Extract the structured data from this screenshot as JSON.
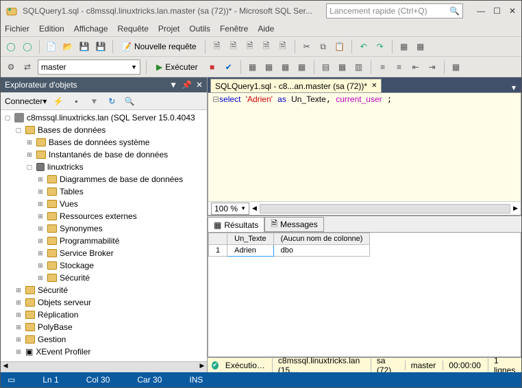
{
  "title": "SQLQuery1.sql - c8mssql.linuxtricks.lan.master (sa (72))* - Microsoft SQL Ser...",
  "quicklaunch_placeholder": "Lancement rapide (Ctrl+Q)",
  "menu": {
    "file": "Fichier",
    "edit": "Edition",
    "view": "Affichage",
    "query": "Requête",
    "project": "Projet",
    "tools": "Outils",
    "window": "Fenêtre",
    "help": "Aide"
  },
  "toolbar": {
    "new_query": "Nouvelle requête"
  },
  "toolbar2": {
    "db": "master",
    "execute": "Exécuter"
  },
  "explorer": {
    "title": "Explorateur d'objets",
    "connect": "Connecter",
    "server": "c8mssql.linuxtricks.lan (SQL Server 15.0.4043",
    "nodes": {
      "databases": "Bases de données",
      "sysdb": "Bases de données système",
      "snapshots": "Instantanés de base de données",
      "linuxtricks": "linuxtricks",
      "diagrams": "Diagrammes de base de données",
      "tables": "Tables",
      "views": "Vues",
      "extres": "Ressources externes",
      "synonyms": "Synonymes",
      "prog": "Programmabilité",
      "sb": "Service Broker",
      "storage": "Stockage",
      "sec_db": "Sécurité",
      "security": "Sécurité",
      "serverobj": "Objets serveur",
      "replication": "Réplication",
      "polybase": "PolyBase",
      "mgmt": "Gestion",
      "xevent": "XEvent Profiler"
    }
  },
  "tab": {
    "label": "SQLQuery1.sql - c8...an.master (sa (72))*"
  },
  "editor": {
    "kw_select": "select",
    "str": "'Adrien'",
    "kw_as": "as",
    "alias": "Un_Texte",
    "fn": "current_user",
    "line": "select 'Adrien' as Un_Texte, current_user ;"
  },
  "zoom": "100 %",
  "results": {
    "tab_results": "Résultats",
    "tab_messages": "Messages",
    "headers": [
      "Un_Texte",
      "(Aucun nom de colonne)"
    ],
    "rows": [
      [
        "Adrien",
        "dbo"
      ]
    ]
  },
  "qstatus": {
    "state": "Exécutio…",
    "server": "c8mssql.linuxtricks.lan (15…",
    "user": "sa (72)",
    "db": "master",
    "time": "00:00:00",
    "rows": "1 lignes"
  },
  "statusbar": {
    "ln": "Ln 1",
    "col": "Col 30",
    "car": "Car 30",
    "ins": "INS"
  }
}
